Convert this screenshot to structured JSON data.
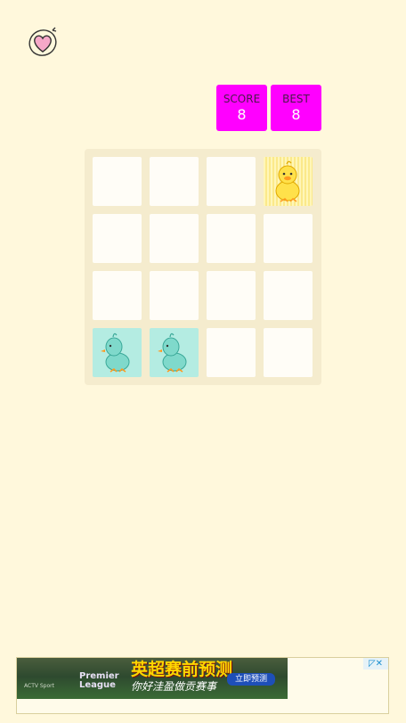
{
  "app": {
    "logo_icon": "heart-orbit-icon"
  },
  "scoreboard": {
    "score_label": "SCORE",
    "score_value": "8",
    "best_label": "BEST",
    "best_value": "8",
    "box_color": "#ff00ff"
  },
  "board": {
    "rows": 4,
    "cols": 4,
    "tiles": [
      [
        "empty",
        "empty",
        "empty",
        "yellow-duck"
      ],
      [
        "empty",
        "empty",
        "empty",
        "empty"
      ],
      [
        "empty",
        "empty",
        "empty",
        "empty"
      ],
      [
        "teal-duck",
        "teal-duck",
        "empty",
        "empty"
      ]
    ],
    "colors": {
      "board": "#f5ecce",
      "empty": "#fffdf7",
      "teal": "#b4ece2",
      "yellow": "#fbe98a"
    }
  },
  "ad": {
    "brand": "ACTV Sport",
    "league_line1": "Premier",
    "league_line2": "League",
    "headline": "英超赛前预测",
    "subline": "你好洼盈做贡赛事",
    "cta": "立即预测",
    "controls_icon": "ad-close-icon",
    "controls_text": "◸✕"
  }
}
